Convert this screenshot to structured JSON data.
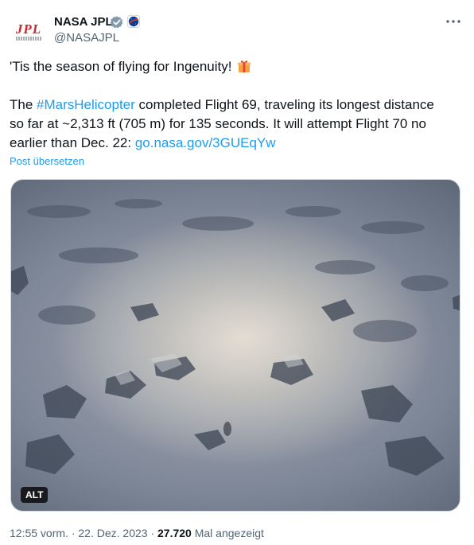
{
  "author": {
    "name": "NASA JPL",
    "handle": "@NASAJPL",
    "avatar_text": "JPL",
    "verified_icon": "verified-check-icon",
    "affiliate_badge": "nasa-meatball-icon"
  },
  "menu_icon": "more-options-icon",
  "tweet": {
    "line1": "'Tis the season of flying for Ingenuity!",
    "line1_emoji": "gift-icon",
    "line2_prefix": "The ",
    "hashtag": "#MarsHelicopter",
    "line2_suffix": " completed Flight 69, traveling its longest distance",
    "line3": "so far at ~2,313 ft (705 m) for 135 seconds. It will attempt Flight 70 no",
    "line4_prefix": "earlier than Dec. 22: ",
    "link": "go.nasa.gov/3GUEqYw"
  },
  "translate_label": "Post übersetzen",
  "media": {
    "alt_badge": "ALT"
  },
  "meta": {
    "time": "12:55 vorm.",
    "sep1": " · ",
    "date": "22. Dez. 2023",
    "sep2": " · ",
    "views": "27.720",
    "views_label": " Mal angezeigt"
  },
  "colors": {
    "accent": "#1d9bf0",
    "text": "#0f1419",
    "secondary": "#536471",
    "jpl_red": "#d1252b"
  }
}
